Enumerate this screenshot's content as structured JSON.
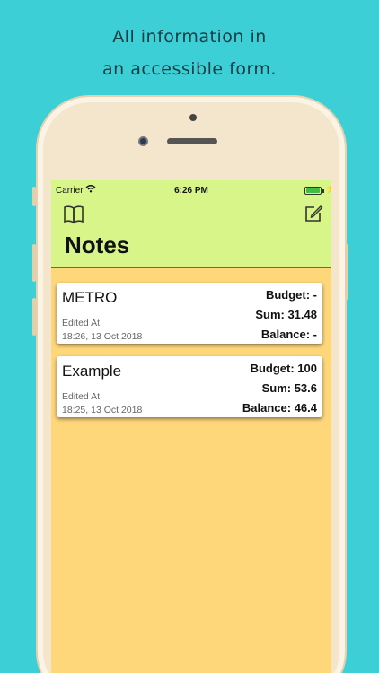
{
  "caption": {
    "line1": "All information in",
    "line2": "an accessible form."
  },
  "status_bar": {
    "carrier": "Carrier",
    "time": "6:26 PM",
    "battery_color": "#3fbf3f"
  },
  "nav": {
    "title": "Notes",
    "left_icon": "book-icon",
    "right_icon": "compose-icon",
    "background": "#d8f58a"
  },
  "content_background": "#ffd77b",
  "notes": [
    {
      "name": "METRO",
      "edited_label": "Edited At:",
      "edited_at": "18:26, 13 Oct 2018",
      "budget": "Budget: -",
      "sum": "Sum: 31.48",
      "balance": "Balance: -"
    },
    {
      "name": "Example",
      "edited_label": "Edited At:",
      "edited_at": "18:25, 13 Oct 2018",
      "budget": "Budget: 100",
      "sum": "Sum: 53.6",
      "balance": "Balance: 46.4"
    }
  ]
}
